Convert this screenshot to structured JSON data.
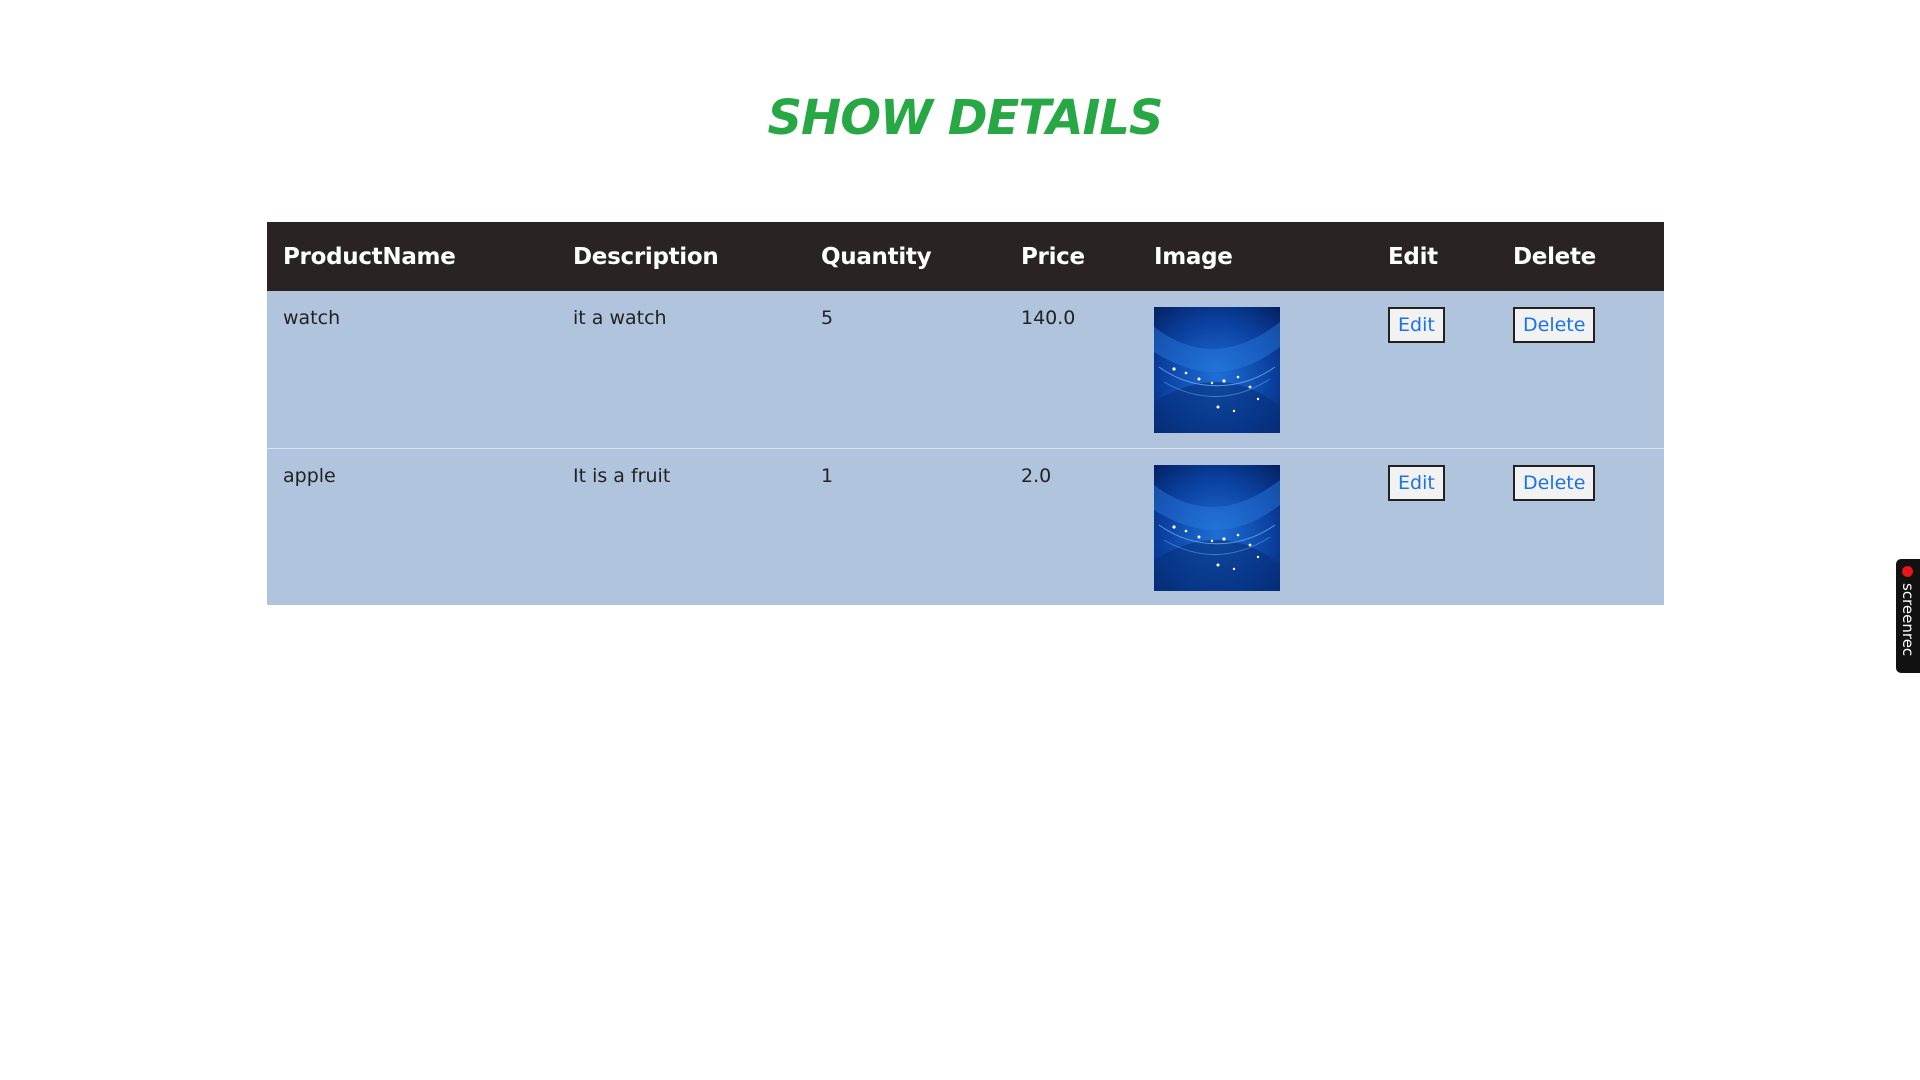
{
  "page": {
    "title": "SHOW DETAILS"
  },
  "table": {
    "headers": [
      "ProductName",
      "Description",
      "Quantity",
      "Price",
      "Image",
      "Edit",
      "Delete"
    ],
    "rows": [
      {
        "product_name": "watch",
        "description": "it a watch",
        "quantity": "5",
        "price": "140.0",
        "edit_label": "Edit",
        "delete_label": "Delete"
      },
      {
        "product_name": "apple",
        "description": "It is a fruit",
        "quantity": "1",
        "price": "2.0",
        "edit_label": "Edit",
        "delete_label": "Delete"
      }
    ]
  },
  "recorder_widget": {
    "label": "screenrec"
  },
  "colors": {
    "title": "#28a745",
    "header_bg": "#292423",
    "row_bg": "#b0c4de",
    "link": "#1a73e8"
  }
}
